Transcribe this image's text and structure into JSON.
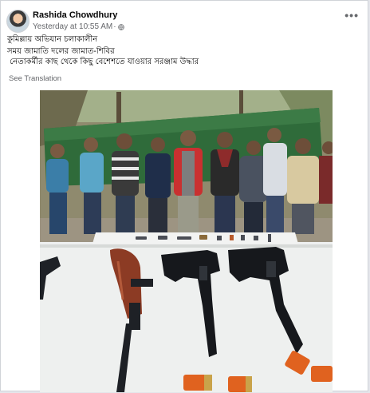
{
  "post": {
    "author": "Rashida Chowdhury",
    "timestamp": "Yesterday at 10:55 AM",
    "separator": "·",
    "privacy_icon": "globe-icon",
    "more_label": "•••",
    "text_lines": [
      "কুমিল্লায় অভিযান চলাকালীন",
      "সময় জামাতি দলের জামাত-শিবির",
      " নেতাকর্মীর কাছ থেকে কিছু বেশেশতে যাওয়ার সরঞ্জাম উদ্ধার"
    ],
    "see_translation": "See Translation"
  },
  "colors": {
    "name": "#050505",
    "secondary_text": "#65676b",
    "banner_green": "#2f6b3a",
    "table_top": "#eef0ef"
  }
}
